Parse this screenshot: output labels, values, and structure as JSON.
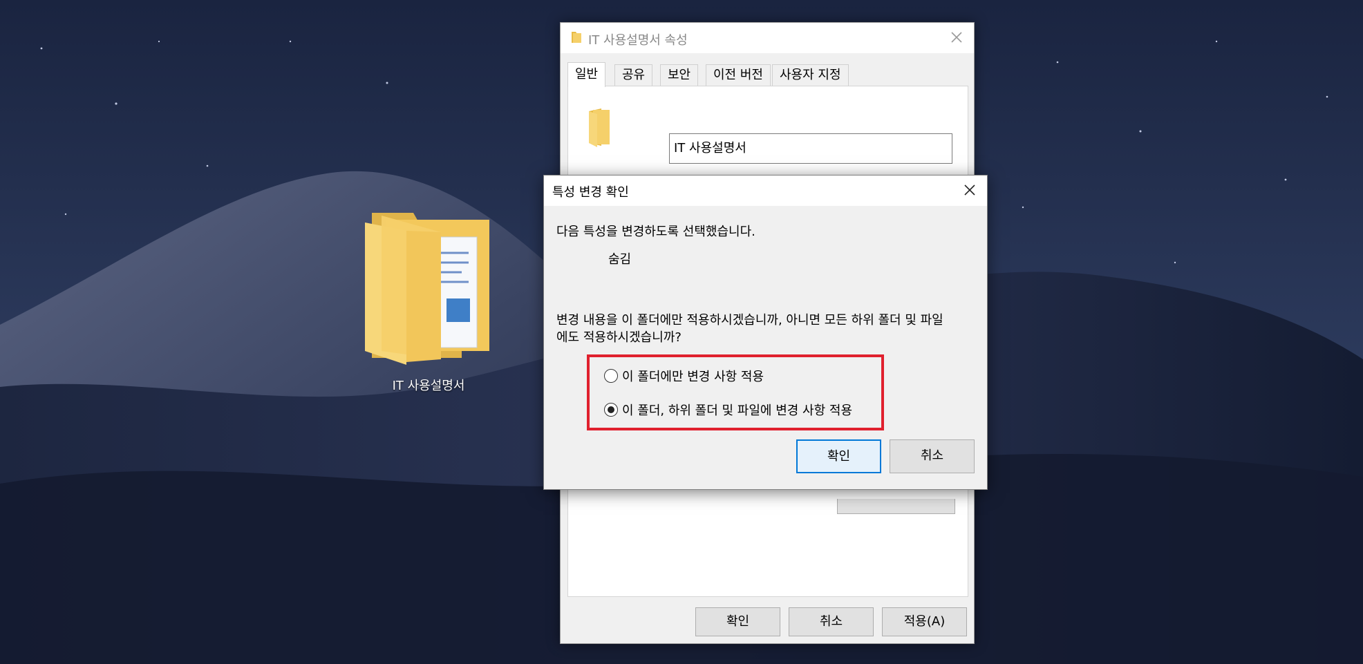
{
  "desktop": {
    "folder_label": "IT 사용설명서"
  },
  "properties_window": {
    "title": "IT 사용설명서 속성",
    "tabs": [
      {
        "label": "일반",
        "active": true
      },
      {
        "label": "공유",
        "active": false
      },
      {
        "label": "보안",
        "active": false
      },
      {
        "label": "이전 버전",
        "active": false
      },
      {
        "label": "사용자 지정",
        "active": false
      }
    ],
    "name_field_value": "IT 사용설명서",
    "buttons": {
      "ok": "확인",
      "cancel": "취소",
      "apply": "적용(A)"
    }
  },
  "confirm_dialog": {
    "title": "특성 변경 확인",
    "intro": "다음 특성을 변경하도록 선택했습니다.",
    "attribute": "숨김",
    "question_line1": "변경 내용을 이 폴더에만 적용하시겠습니까, 아니면 모든 하위 폴더 및 파일",
    "question_line2": "에도 적용하시겠습니까?",
    "options": [
      {
        "label": "이 폴더에만 변경 사항 적용",
        "selected": false
      },
      {
        "label": "이 폴더, 하위 폴더 및 파일에 변경 사항 적용",
        "selected": true
      }
    ],
    "buttons": {
      "ok": "확인",
      "cancel": "취소"
    }
  },
  "colors": {
    "highlight": "#e0202e",
    "accent": "#0078d7",
    "folder": "#f4c95d"
  }
}
